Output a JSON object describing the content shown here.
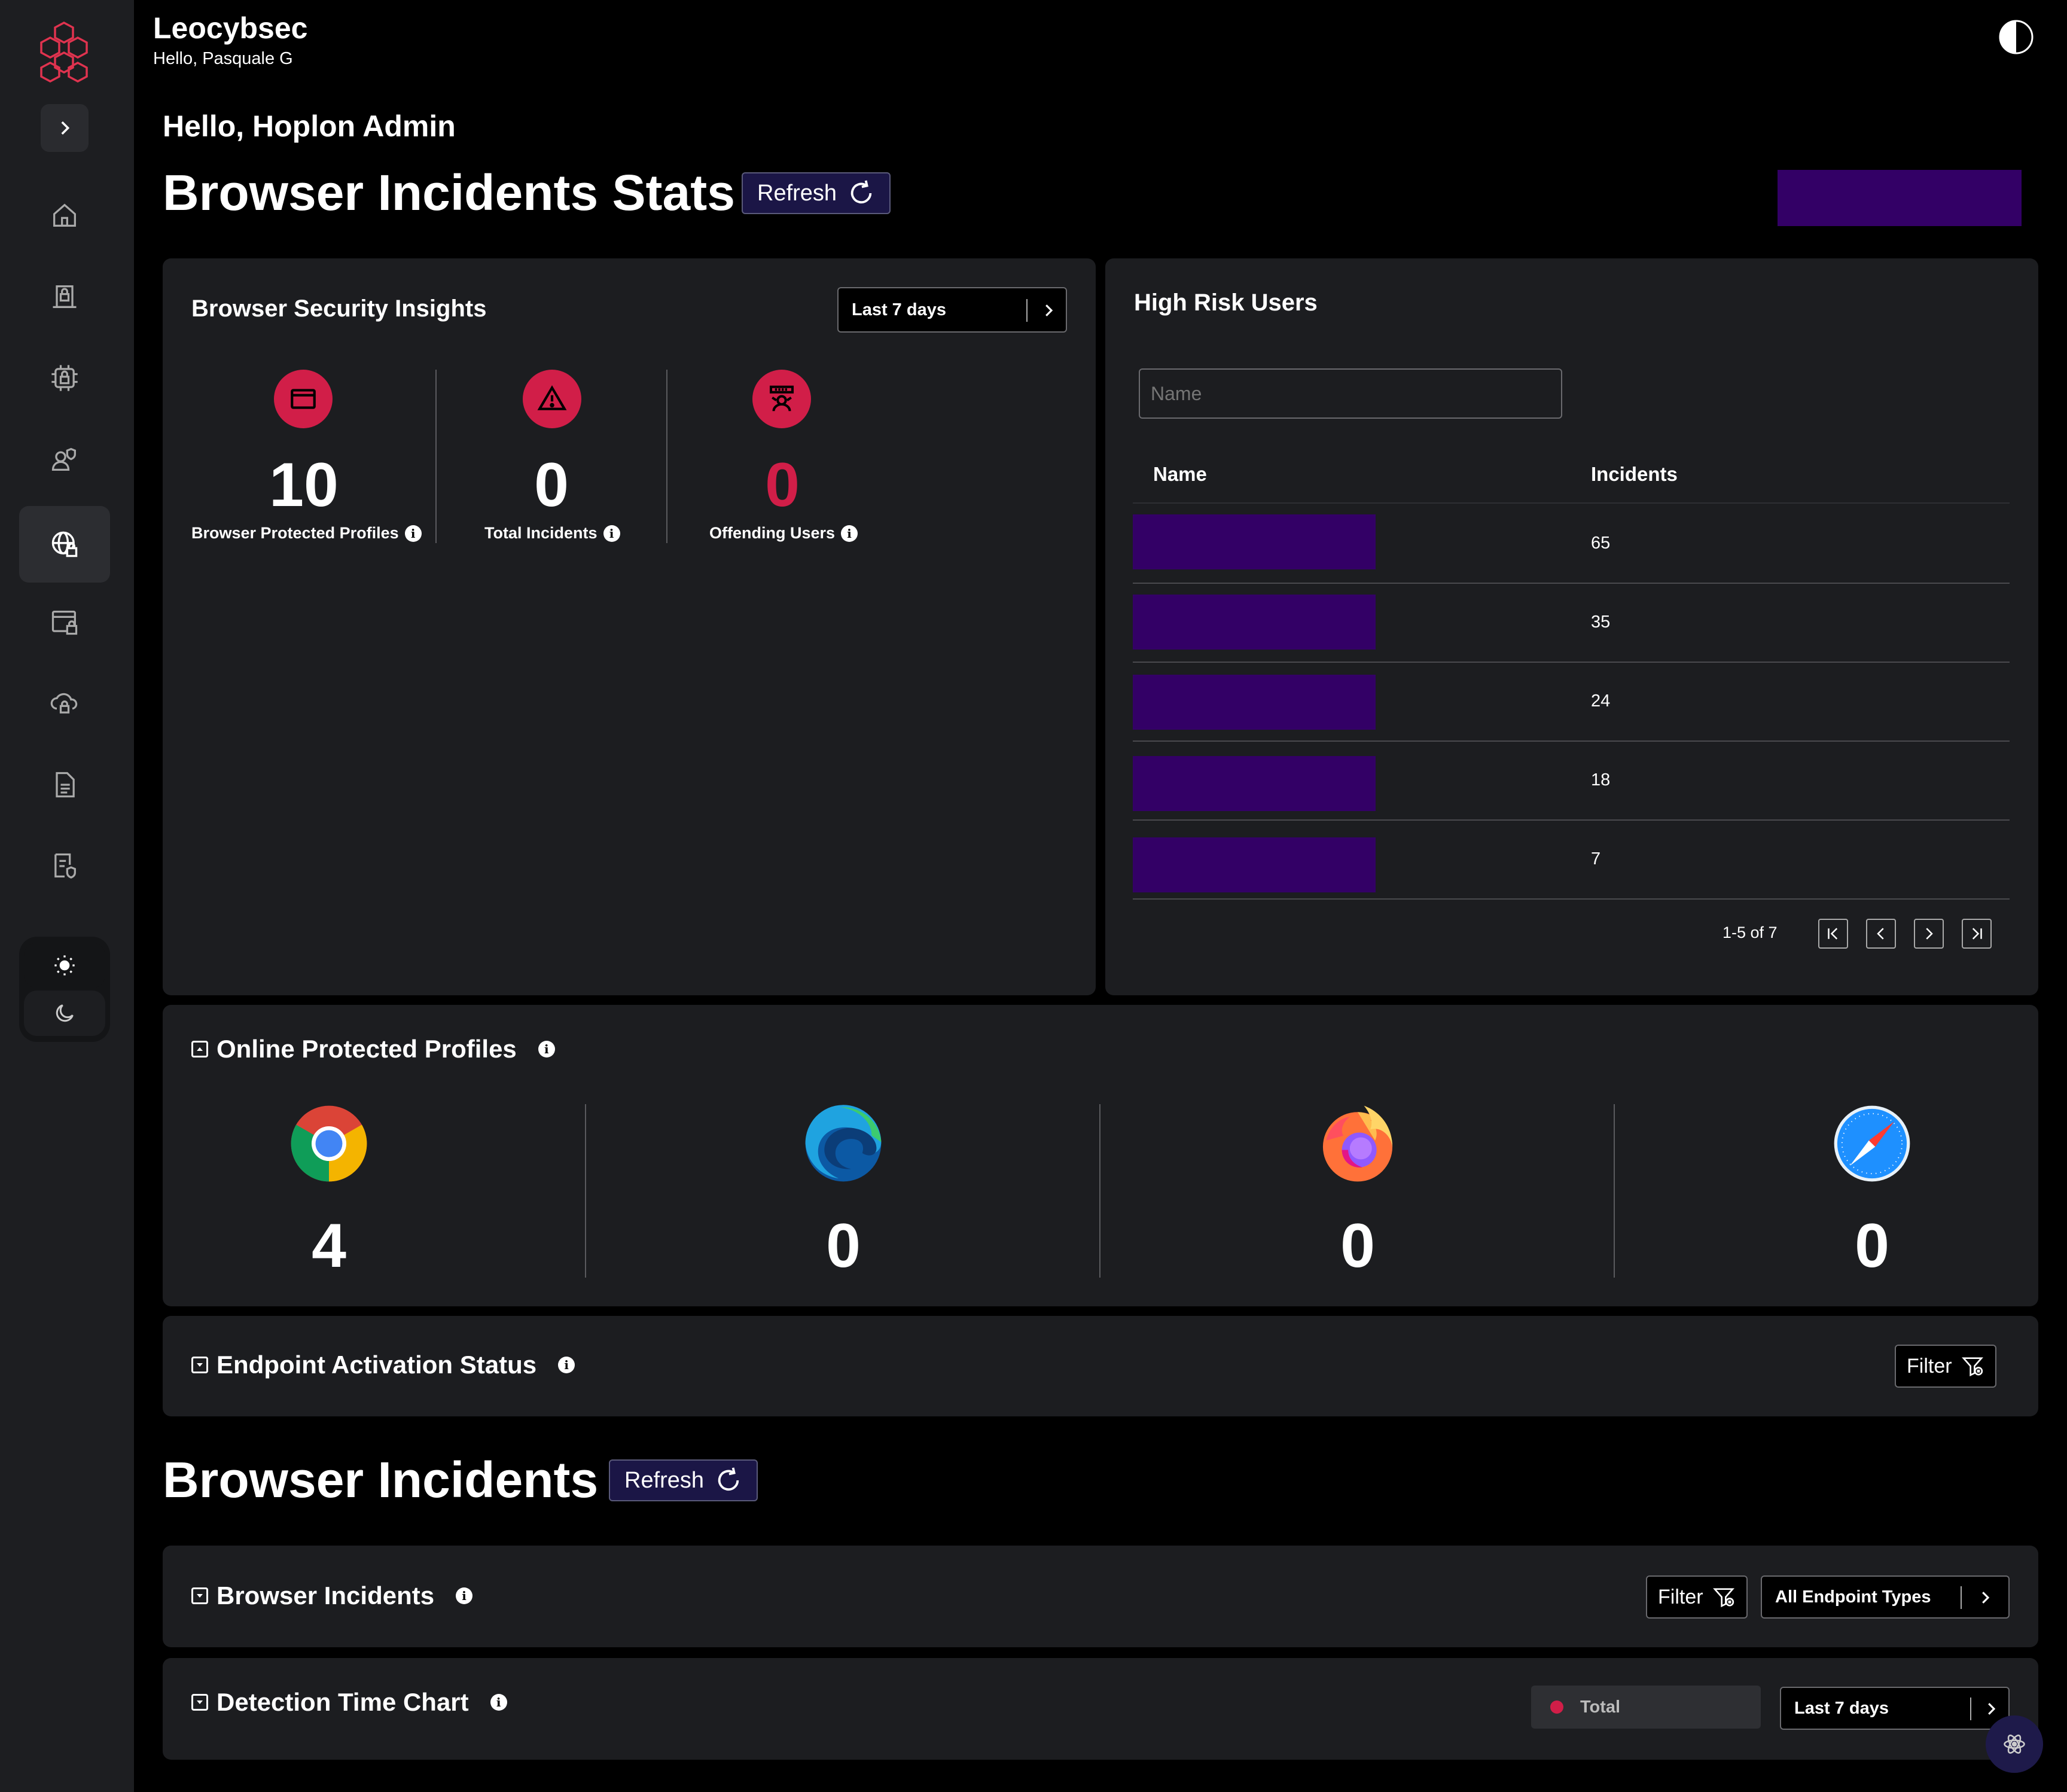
{
  "app": {
    "name": "Leocybsec",
    "greeting": "Hello, Pasquale G"
  },
  "sidebar": {
    "items": [
      {
        "name": "home-icon"
      },
      {
        "name": "office-building-lock-icon"
      },
      {
        "name": "chip-lock-icon"
      },
      {
        "name": "user-shield-icon"
      },
      {
        "name": "globe-lock-icon",
        "active": true
      },
      {
        "name": "browser-window-lock-icon"
      },
      {
        "name": "cloud-lock-icon"
      },
      {
        "name": "document-icon"
      },
      {
        "name": "document-shield-icon"
      }
    ],
    "theme": {
      "light": "sun-icon",
      "dark": "moon-icon"
    }
  },
  "main": {
    "hello": "Hello, Hoplon Admin",
    "title": "Browser Incidents Stats",
    "refresh_label": "Refresh",
    "accent_color": "#330066"
  },
  "insights": {
    "title": "Browser Security Insights",
    "range": "Last 7 days",
    "stats": [
      {
        "value": "10",
        "label": "Browser Protected Profiles",
        "icon": "browser-window-icon"
      },
      {
        "value": "0",
        "label": "Total Incidents",
        "icon": "warning-triangle-icon"
      },
      {
        "value": "0",
        "label": "Offending Users",
        "icon": "user-alert-icon",
        "color": "#d11e48"
      }
    ]
  },
  "high_risk": {
    "title": "High Risk Users",
    "search_placeholder": "Name",
    "columns": [
      "Name",
      "Incidents"
    ],
    "rows": [
      {
        "incidents": "65"
      },
      {
        "incidents": "35"
      },
      {
        "incidents": "24"
      },
      {
        "incidents": "18"
      },
      {
        "incidents": "7"
      }
    ],
    "pagination": "1-5 of 7"
  },
  "online_profiles": {
    "title": "Online Protected Profiles",
    "browsers": [
      {
        "icon": "chrome-icon",
        "value": "4"
      },
      {
        "icon": "edge-icon",
        "value": "0"
      },
      {
        "icon": "firefox-icon",
        "value": "0"
      },
      {
        "icon": "safari-icon",
        "value": "0"
      }
    ]
  },
  "endpoint_status": {
    "title": "Endpoint Activation Status",
    "filter_label": "Filter"
  },
  "incidents_section": {
    "title": "Browser Incidents",
    "refresh_label": "Refresh"
  },
  "browser_incidents": {
    "title": "Browser Incidents",
    "filter_label": "Filter",
    "endpoint_select": "All Endpoint Types"
  },
  "detection_chart": {
    "title": "Detection Time Chart",
    "legend": "Total",
    "legend_color": "#d11e48",
    "range": "Last 7 days"
  }
}
